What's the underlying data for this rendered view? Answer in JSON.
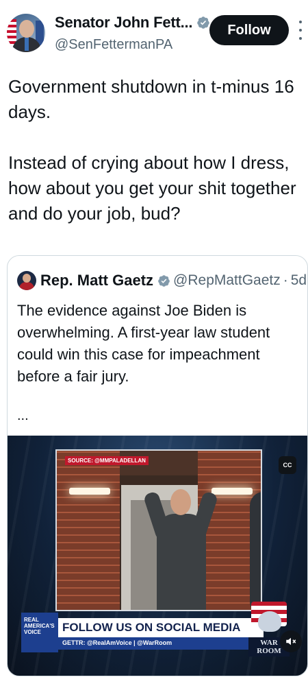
{
  "author": {
    "display_name": "Senator John Fett...",
    "handle": "@SenFettermanPA",
    "avatar_icon": "profile-photo",
    "verified_icon": "verified-badge-icon"
  },
  "follow_label": "Follow",
  "more_icon": "more-vertical-icon",
  "tweet_text": "Government shutdown in t-minus 16 days.\n\nInstead of crying about how I dress, how about you get your shit together and do your job, bud?",
  "quoted": {
    "display_name": "Rep. Matt Gaetz",
    "handle": "@RepMattGaetz",
    "separator": "·",
    "time": "5d",
    "text": "The evidence against Joe Biden is overwhelming. A first-year law student could win this case for impeachment before a fair jury.",
    "ellipsis": "...",
    "video": {
      "source_tag": "SOURCE: @MMPALADELLAN",
      "cc_label": "CC",
      "banner_logo": "REAL AMERICA'S VOICE",
      "banner_title": "FOLLOW US ON SOCIAL MEDIA",
      "banner_sub": "GETTR: @RealAmVoice | @WarRoom",
      "war_room_label": "WAR ROOM",
      "mute_icon": "speaker-muted-icon"
    }
  },
  "colors": {
    "text": "#0f1419",
    "secondary": "#536471",
    "verified": "#829aab",
    "follow_bg": "#0f1419",
    "border": "#cfd9de"
  }
}
